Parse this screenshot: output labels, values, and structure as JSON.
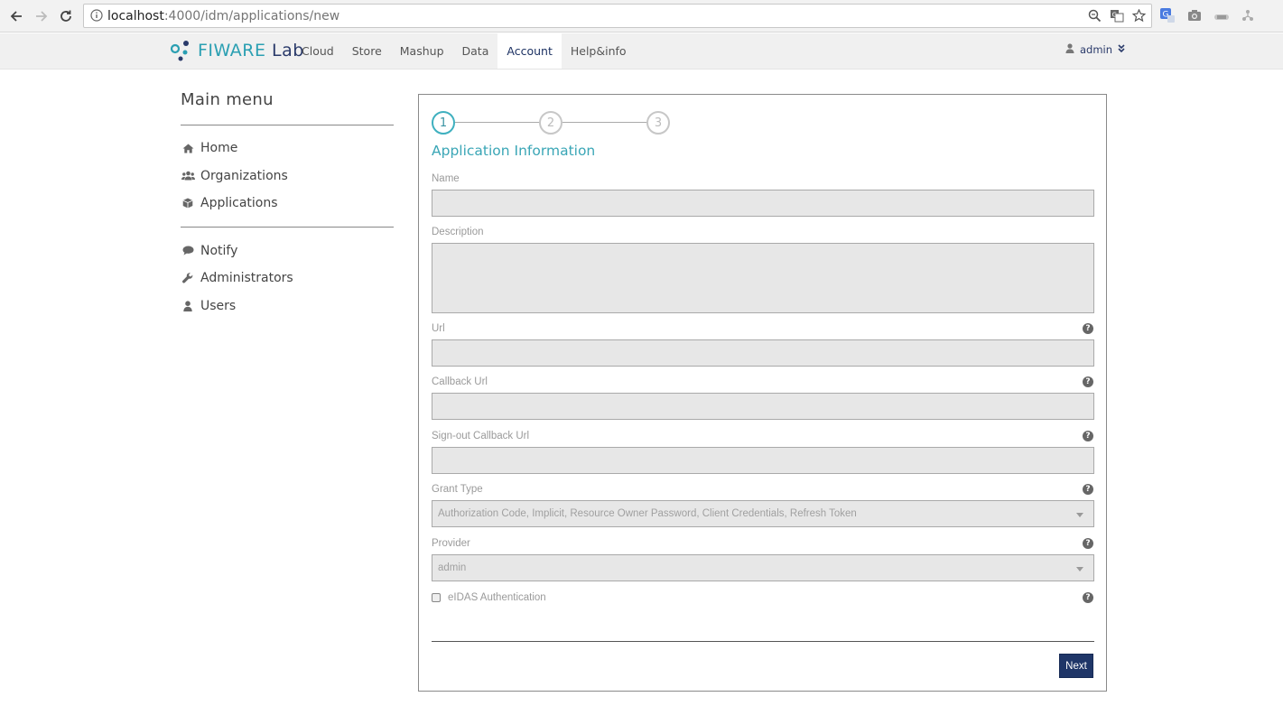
{
  "browser": {
    "url_host": "localhost",
    "url_path": ":4000/idm/applications/new"
  },
  "header": {
    "logo_primary": "FIWARE",
    "logo_secondary": "Lab",
    "nav": [
      {
        "label": "Cloud"
      },
      {
        "label": "Store"
      },
      {
        "label": "Mashup"
      },
      {
        "label": "Data"
      },
      {
        "label": "Account"
      },
      {
        "label": "Help&info"
      }
    ],
    "active_nav": "Account",
    "user": "admin"
  },
  "sidebar": {
    "title": "Main menu",
    "group1": [
      {
        "label": "Home",
        "icon": "home-icon"
      },
      {
        "label": "Organizations",
        "icon": "users-icon"
      },
      {
        "label": "Applications",
        "icon": "cube-icon"
      }
    ],
    "group2": [
      {
        "label": "Notify",
        "icon": "comment-icon"
      },
      {
        "label": "Administrators",
        "icon": "wrench-icon"
      },
      {
        "label": "Users",
        "icon": "user-icon"
      }
    ]
  },
  "wizard": {
    "steps": [
      "1",
      "2",
      "3"
    ],
    "current_step": 1,
    "title": "Application Information"
  },
  "form": {
    "name_label": "Name",
    "name_value": "",
    "description_label": "Description",
    "description_value": "",
    "url_label": "Url",
    "url_value": "",
    "callback_label": "Callback Url",
    "callback_value": "",
    "signout_label": "Sign-out Callback Url",
    "signout_value": "",
    "grant_label": "Grant Type",
    "grant_value": "Authorization Code, Implicit, Resource Owner Password, Client Credentials, Refresh Token",
    "provider_label": "Provider",
    "provider_value": "admin",
    "eidas_label": "eIDAS Authentication",
    "eidas_checked": false,
    "help_glyph": "?",
    "next_label": "Next"
  },
  "colors": {
    "accent": "#3aa6b6",
    "brand_dark": "#1f3668"
  }
}
